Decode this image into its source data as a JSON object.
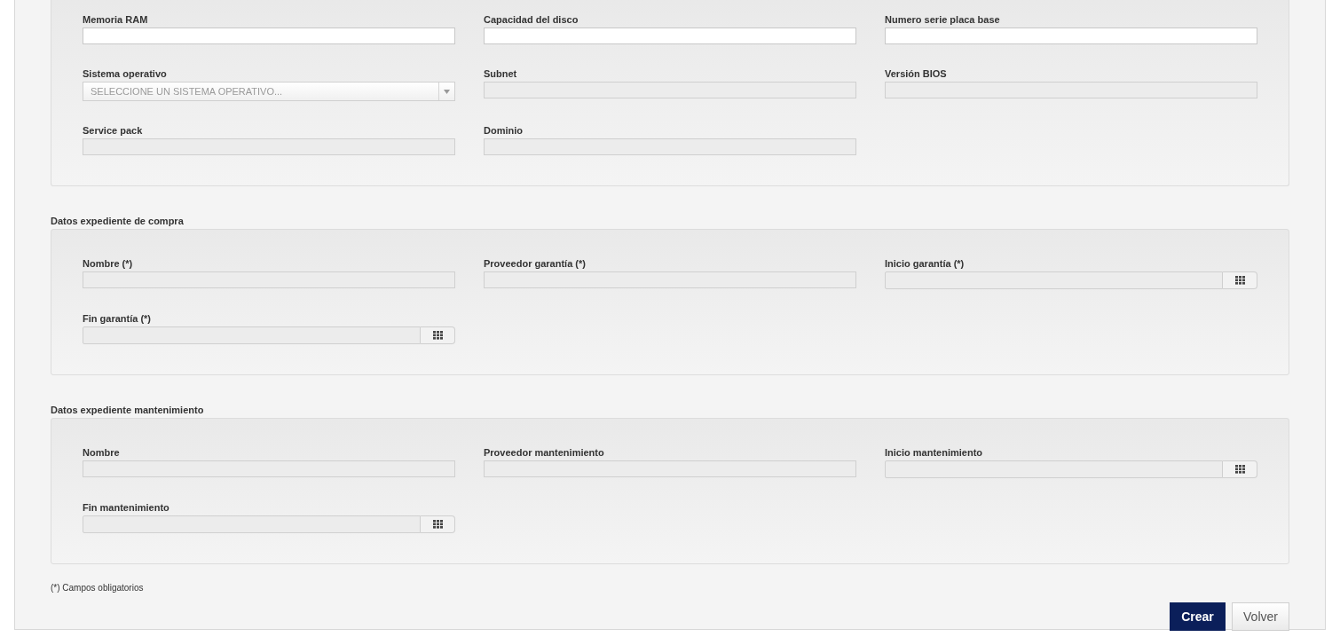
{
  "sections": [
    {
      "fields": [
        {
          "label": "Memoria RAM",
          "kind": "text"
        },
        {
          "label": "Capacidad del disco",
          "kind": "text"
        },
        {
          "label": "Numero serie placa base",
          "kind": "text"
        },
        {
          "label": "Sistema operativo",
          "kind": "select",
          "placeholder": "SELECCIONE UN SISTEMA OPERATIVO..."
        },
        {
          "label": "Subnet",
          "kind": "disabled"
        },
        {
          "label": "Versión BIOS",
          "kind": "disabled"
        },
        {
          "label": "Service pack",
          "kind": "disabled"
        },
        {
          "label": "Dominio",
          "kind": "disabled"
        }
      ]
    },
    {
      "title": "Datos expediente de compra",
      "fields": [
        {
          "label": "Nombre (*)",
          "kind": "disabled"
        },
        {
          "label": "Proveedor garantía (*)",
          "kind": "disabled"
        },
        {
          "label": "Inicio garantía (*)",
          "kind": "date"
        },
        {
          "label": "Fin garantía (*)",
          "kind": "date"
        }
      ]
    },
    {
      "title": "Datos expediente mantenimiento",
      "fields": [
        {
          "label": "Nombre",
          "kind": "disabled"
        },
        {
          "label": "Proveedor mantenimiento",
          "kind": "disabled"
        },
        {
          "label": "Inicio mantenimiento",
          "kind": "date"
        },
        {
          "label": "Fin mantenimiento",
          "kind": "date"
        }
      ]
    }
  ],
  "note": "(*) Campos obligatorios",
  "buttons": [
    {
      "label": "Crear",
      "kind": "primary"
    },
    {
      "label": "Volver",
      "kind": "secondary"
    }
  ]
}
